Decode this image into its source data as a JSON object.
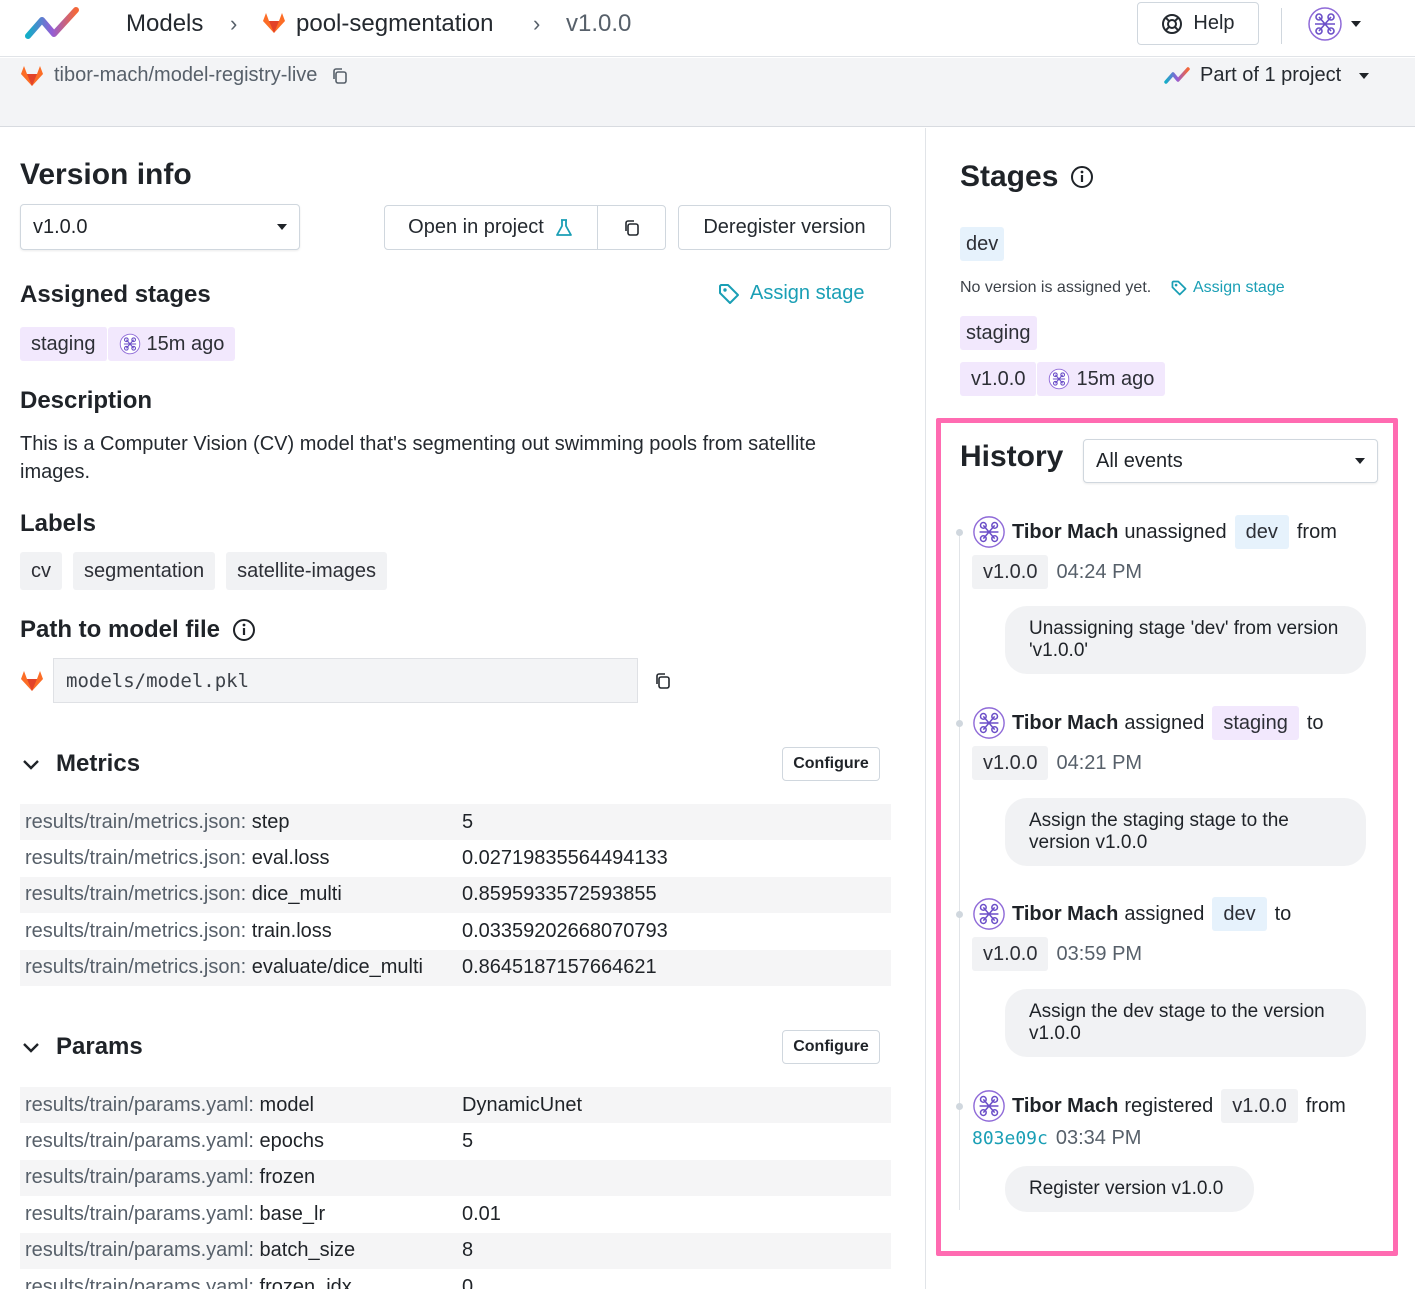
{
  "breadcrumb": {
    "models": "Models",
    "model": "pool-segmentation",
    "version": "v1.0.0"
  },
  "header": {
    "help": "Help"
  },
  "subbar": {
    "repo": "tibor-mach/model-registry-live",
    "part_of": "Part of 1 project"
  },
  "version_info": {
    "title": "Version info",
    "selected_version": "v1.0.0",
    "open_in_project": "Open in project",
    "deregister": "Deregister version"
  },
  "assigned_stages": {
    "title": "Assigned stages",
    "assign_link": "Assign stage",
    "stage": "staging",
    "time": "15m ago"
  },
  "description": {
    "title": "Description",
    "text": "This is a Computer Vision (CV) model that's segmenting out swimming pools from satellite images."
  },
  "labels": {
    "title": "Labels",
    "items": [
      "cv",
      "segmentation",
      "satellite-images"
    ]
  },
  "path": {
    "title": "Path to model file",
    "value": "models/model.pkl"
  },
  "metrics": {
    "title": "Metrics",
    "configure": "Configure",
    "rows": [
      {
        "prefix": "results/train/metrics.json:",
        "key": "step",
        "value": "5"
      },
      {
        "prefix": "results/train/metrics.json:",
        "key": "eval.loss",
        "value": "0.02719835564494133"
      },
      {
        "prefix": "results/train/metrics.json:",
        "key": "dice_multi",
        "value": "0.8595933572593855"
      },
      {
        "prefix": "results/train/metrics.json:",
        "key": "train.loss",
        "value": "0.03359202668070793"
      },
      {
        "prefix": "results/train/metrics.json:",
        "key": "evaluate/dice_multi",
        "value": "0.8645187157664621"
      }
    ]
  },
  "params": {
    "title": "Params",
    "configure": "Configure",
    "rows": [
      {
        "prefix": "results/train/params.yaml:",
        "key": "model",
        "value": "DynamicUnet"
      },
      {
        "prefix": "results/train/params.yaml:",
        "key": "epochs",
        "value": "5"
      },
      {
        "prefix": "results/train/params.yaml:",
        "key": "frozen",
        "value": ""
      },
      {
        "prefix": "results/train/params.yaml:",
        "key": "base_lr",
        "value": "0.01"
      },
      {
        "prefix": "results/train/params.yaml:",
        "key": "batch_size",
        "value": "8"
      },
      {
        "prefix": "results/train/params.yaml:",
        "key": "frozen_idx",
        "value": "0"
      }
    ]
  },
  "stages": {
    "title": "Stages",
    "dev": {
      "name": "dev",
      "empty": "No version is assigned yet.",
      "assign": "Assign stage"
    },
    "staging": {
      "name": "staging",
      "version": "v1.0.0",
      "time": "15m ago"
    }
  },
  "history": {
    "title": "History",
    "filter": "All events",
    "events": [
      {
        "user": "Tibor Mach",
        "action": "unassigned",
        "stage": "dev",
        "conj": "from",
        "version": "v1.0.0",
        "time": "04:24 PM",
        "message": "Unassigning stage 'dev' from version 'v1.0.0'"
      },
      {
        "user": "Tibor Mach",
        "action": "assigned",
        "stage": "staging",
        "conj": "to",
        "version": "v1.0.0",
        "time": "04:21 PM",
        "message": "Assign the staging stage to the version v1.0.0"
      },
      {
        "user": "Tibor Mach",
        "action": "assigned",
        "stage": "dev",
        "conj": "to",
        "version": "v1.0.0",
        "time": "03:59 PM",
        "message": "Assign the dev stage to the version v1.0.0"
      },
      {
        "user": "Tibor Mach",
        "action": "registered",
        "stage": "v1.0.0",
        "conj": "from",
        "commit": "803e09c",
        "time": "03:34 PM",
        "message": "Register version v1.0.0"
      }
    ]
  },
  "colors": {
    "accent": "#1a9fb5",
    "highlight": "#ff6bb1",
    "stage_purple": "#f2e8fd",
    "stage_blue": "#e6f2fc"
  }
}
